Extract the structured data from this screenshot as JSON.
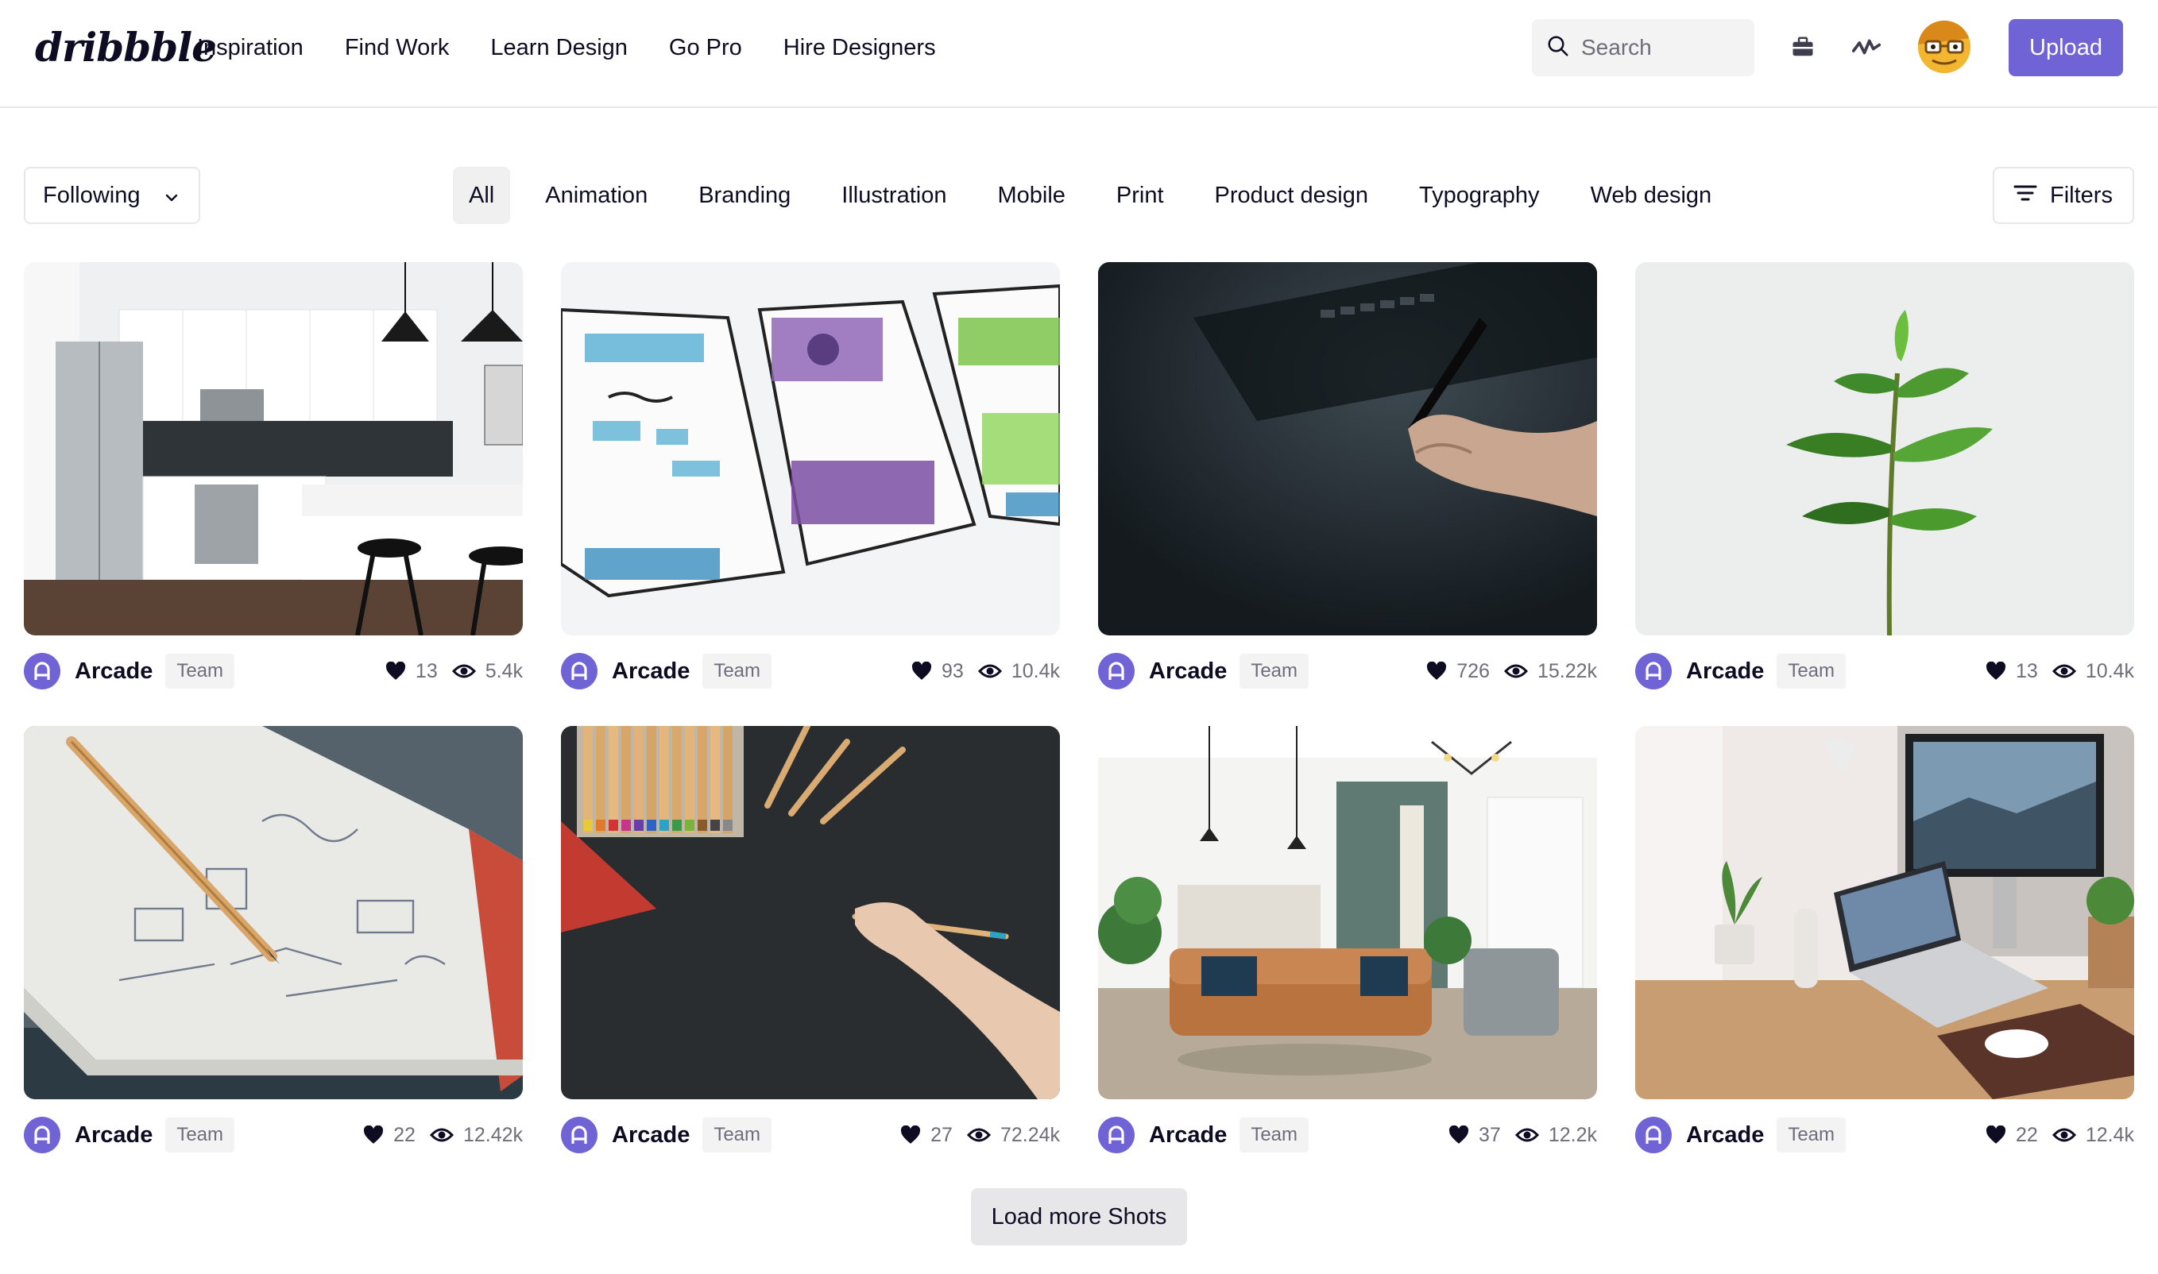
{
  "header": {
    "logo": "dribbble",
    "nav": [
      "Inspiration",
      "Find Work",
      "Learn Design",
      "Go Pro",
      "Hire Designers"
    ],
    "search_placeholder": "Search",
    "upload_label": "Upload",
    "icons": [
      "search-icon",
      "briefcase-icon",
      "activity-icon",
      "avatar"
    ]
  },
  "filter_bar": {
    "following_label": "Following",
    "categories": [
      "All",
      "Animation",
      "Branding",
      "Illustration",
      "Mobile",
      "Print",
      "Product design",
      "Typography",
      "Web design"
    ],
    "active_category": "All",
    "filters_label": "Filters"
  },
  "shots": [
    {
      "author": "Arcade",
      "badge": "Team",
      "likes": "13",
      "views": "5.4k",
      "image": "kitchen"
    },
    {
      "author": "Arcade",
      "badge": "Team",
      "likes": "93",
      "views": "10.4k",
      "image": "wireframe-sketches"
    },
    {
      "author": "Arcade",
      "badge": "Team",
      "likes": "726",
      "views": "15.22k",
      "image": "stylus-tablet"
    },
    {
      "author": "Arcade",
      "badge": "Team",
      "likes": "13",
      "views": "10.4k",
      "image": "plant"
    },
    {
      "author": "Arcade",
      "badge": "Team",
      "likes": "22",
      "views": "12.42k",
      "image": "notebook-sketch"
    },
    {
      "author": "Arcade",
      "badge": "Team",
      "likes": "27",
      "views": "72.24k",
      "image": "colored-pencils"
    },
    {
      "author": "Arcade",
      "badge": "Team",
      "likes": "37",
      "views": "12.2k",
      "image": "living-room"
    },
    {
      "author": "Arcade",
      "badge": "Team",
      "likes": "22",
      "views": "12.4k",
      "image": "desk-setup"
    }
  ],
  "load_more_label": "Load more Shots",
  "colors": {
    "brand": "#6f63d6",
    "text": "#0d0c22",
    "muted": "#6e6d7a",
    "chip": "#f3f3f4"
  }
}
